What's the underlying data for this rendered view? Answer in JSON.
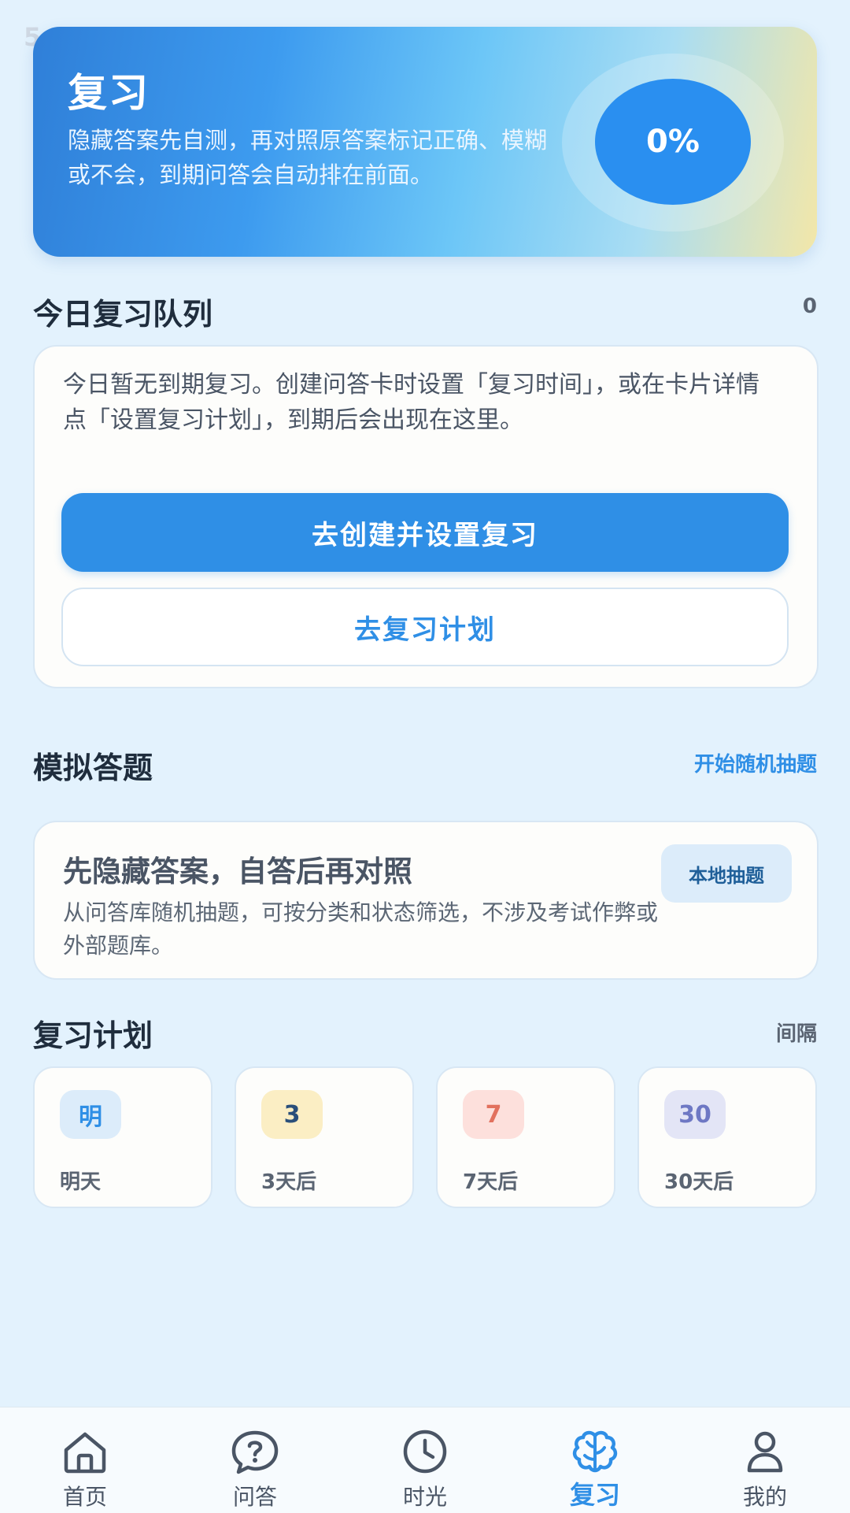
{
  "status_bar": {
    "time": "5"
  },
  "hero": {
    "title": "复习",
    "description": "隐藏答案先自测，再对照原答案标记正确、模糊或不会，到期问答会自动排在前面。",
    "progress_label": "0%",
    "progress_value": 0
  },
  "queue": {
    "title": "今日复习队列",
    "count": "0",
    "empty_text": "今日暂无到期复习。创建问答卡时设置「复习时间」，或在卡片详情点「设置复习计划」，到期后会出现在这里。",
    "primary_button": "去创建并设置复习",
    "secondary_button": "去复习计划"
  },
  "mock": {
    "title": "模拟答题",
    "action": "开始随机抽题",
    "card_title": "先隐藏答案，自答后再对照",
    "card_desc": "从问答库随机抽题，可按分类和状态筛选，不涉及考试作弊或外部题库。",
    "local_button": "本地抽题"
  },
  "plan": {
    "title": "复习计划",
    "right_label": "间隔",
    "items": [
      {
        "badge": "明",
        "label": "明天",
        "badge_bg": "#dcecfa",
        "badge_color": "#2f8fe6"
      },
      {
        "badge": "3",
        "label": "3天后",
        "badge_bg": "#fbeec4",
        "badge_color": "#2a4f7a"
      },
      {
        "badge": "7",
        "label": "7天后",
        "badge_bg": "#fde0dc",
        "badge_color": "#e2715e"
      },
      {
        "badge": "30",
        "label": "30天后",
        "badge_bg": "#e3e5f6",
        "badge_color": "#6e78c4"
      }
    ]
  },
  "nav": {
    "items": [
      {
        "label": "首页",
        "icon": "home-icon"
      },
      {
        "label": "问答",
        "icon": "question-bubble-icon"
      },
      {
        "label": "时光",
        "icon": "clock-icon"
      },
      {
        "label": "复习",
        "icon": "brain-icon",
        "active": true
      },
      {
        "label": "我的",
        "icon": "user-icon"
      }
    ],
    "active_color": "#2f8fe6",
    "inactive_color": "#4a5565"
  }
}
